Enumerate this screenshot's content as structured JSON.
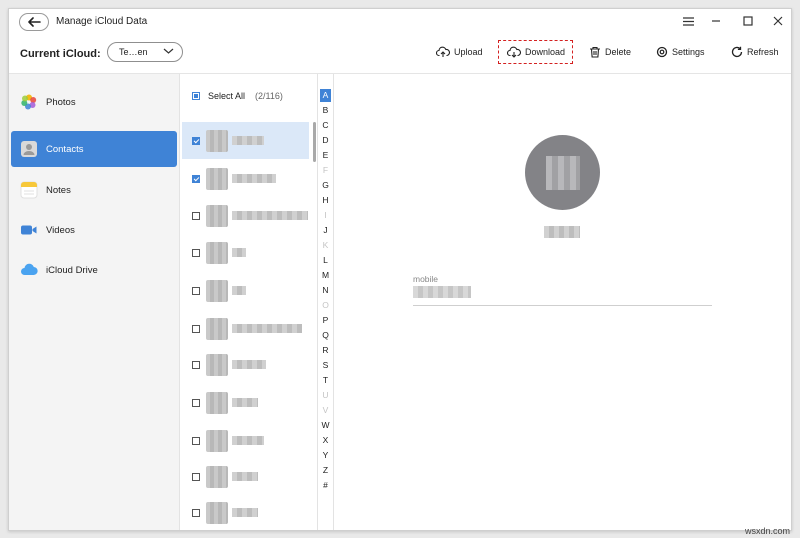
{
  "window": {
    "title": "Manage iCloud Data"
  },
  "toolbar": {
    "current_label": "Current iCloud:",
    "account_value": "Te…en",
    "upload_label": "Upload",
    "download_label": "Download",
    "delete_label": "Delete",
    "settings_label": "Settings",
    "refresh_label": "Refresh"
  },
  "sidebar": {
    "items": [
      {
        "label": "Photos",
        "icon": "photos-icon"
      },
      {
        "label": "Contacts",
        "icon": "contacts-icon",
        "active": true
      },
      {
        "label": "Notes",
        "icon": "notes-icon"
      },
      {
        "label": "Videos",
        "icon": "videos-icon"
      },
      {
        "label": "iCloud Drive",
        "icon": "icloud-drive-icon"
      }
    ]
  },
  "list": {
    "select_all_label": "Select All",
    "count": "(2/116)"
  },
  "alphabet": [
    "A",
    "B",
    "C",
    "D",
    "E",
    "F",
    "G",
    "H",
    "I",
    "J",
    "K",
    "L",
    "M",
    "N",
    "O",
    "P",
    "Q",
    "R",
    "S",
    "T",
    "U",
    "V",
    "W",
    "X",
    "Y",
    "Z",
    "#"
  ],
  "detail": {
    "field_label": "mobile"
  },
  "watermark": "wsxdn.com",
  "colors": {
    "accent": "#3f83d6",
    "highlight": "#d42020"
  }
}
